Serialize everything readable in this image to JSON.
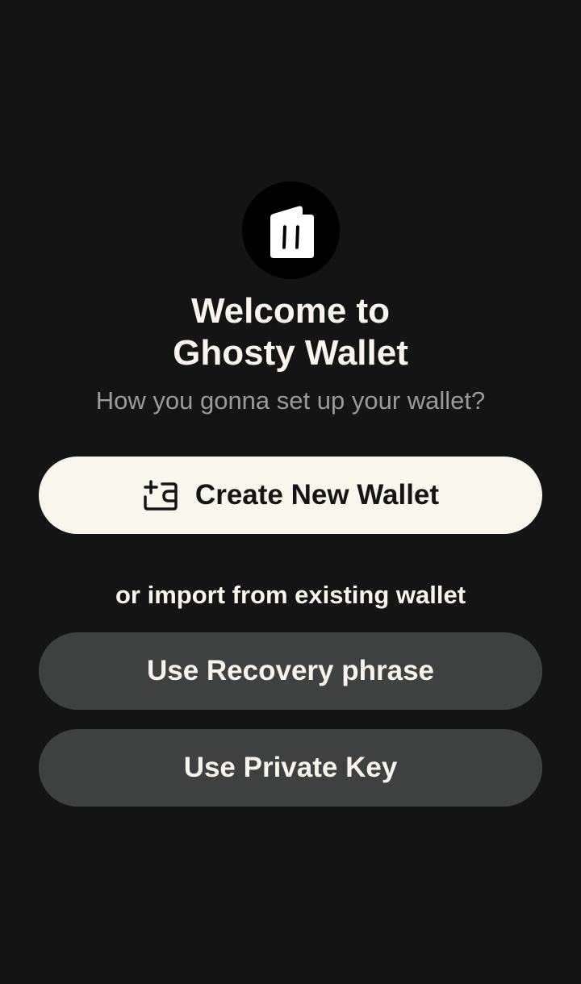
{
  "app": {
    "logo_icon": "ghost-wallet-icon",
    "title_line1": "Welcome to",
    "title_line2": "Ghosty Wallet",
    "subtitle": "How you gonna set up your wallet?"
  },
  "actions": {
    "create_label": "Create New Wallet",
    "create_icon": "add-wallet-icon",
    "import_prompt": "or import from existing wallet",
    "recovery_label": "Use Recovery phrase",
    "private_key_label": "Use Private Key"
  },
  "colors": {
    "background": "#141414",
    "primary_button": "#f9f6ec",
    "secondary_button": "#3f4040",
    "subtitle_text": "#9a9a98"
  }
}
